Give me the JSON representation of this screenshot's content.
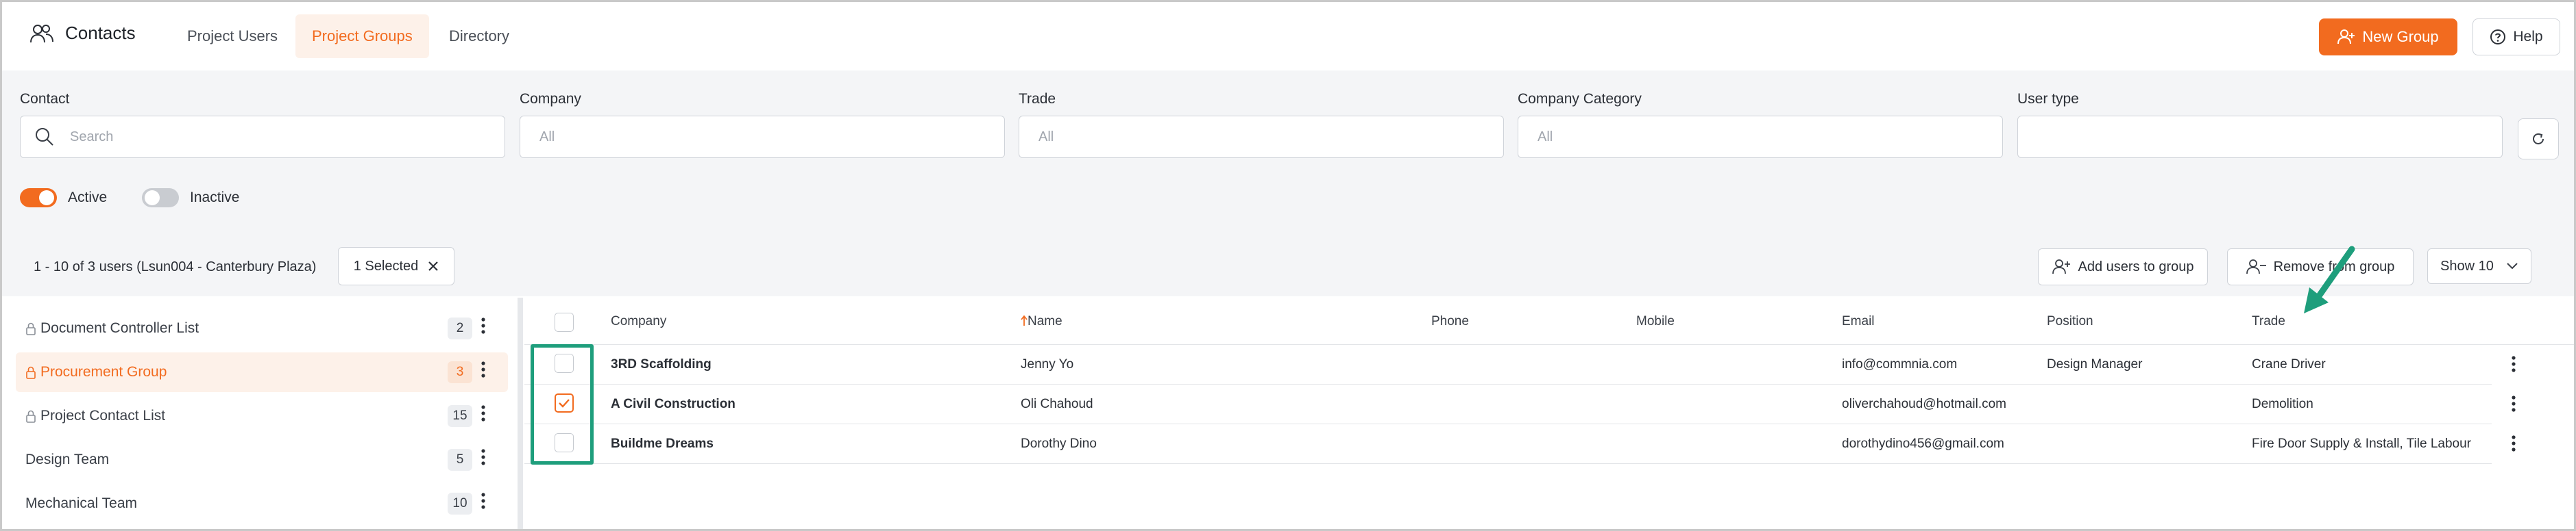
{
  "header": {
    "app_title": "Contacts",
    "tabs": [
      "Project Users",
      "Project Groups",
      "Directory"
    ],
    "active_tab": "Project Groups",
    "new_group_label": "New Group",
    "help_label": "Help"
  },
  "filters": {
    "contact_label": "Contact",
    "contact_placeholder": "Search",
    "company_label": "Company",
    "company_placeholder": "All",
    "trade_label": "Trade",
    "trade_placeholder": "All",
    "company_category_label": "Company Category",
    "company_category_placeholder": "All",
    "user_type_label": "User type",
    "user_type_placeholder": "",
    "active_label": "Active",
    "inactive_label": "Inactive"
  },
  "toolbar": {
    "count_text": "1 - 10 of 3 users (Lsun004 - Canterbury Plaza)",
    "selected_label": "1 Selected",
    "add_users_label": "Add users to group",
    "remove_label": "Remove from group",
    "show_label": "Show 10"
  },
  "groups": [
    {
      "name": "Document Controller List",
      "count": "2",
      "locked": true
    },
    {
      "name": "Procurement Group",
      "count": "3",
      "locked": true
    },
    {
      "name": "Project Contact List",
      "count": "15",
      "locked": true
    },
    {
      "name": "Design Team",
      "count": "5",
      "locked": false
    },
    {
      "name": "Mechanical Team",
      "count": "10",
      "locked": false
    }
  ],
  "table": {
    "columns": [
      "Company",
      "Name",
      "Phone",
      "Mobile",
      "Email",
      "Position",
      "Trade"
    ],
    "rows": [
      {
        "company": "3RD Scaffolding",
        "name": "Jenny Yo",
        "phone": "",
        "mobile": "",
        "email": "info@commnia.com",
        "position": "Design Manager",
        "trade": "Crane Driver"
      },
      {
        "company": "A Civil Construction",
        "name": "Oli Chahoud",
        "phone": "",
        "mobile": "",
        "email": "oliverchahoud@hotmail.com",
        "position": "",
        "trade": "Demolition"
      },
      {
        "company": "Buildme Dreams",
        "name": "Dorothy Dino",
        "phone": "",
        "mobile": "",
        "email": "dorothydino456@gmail.com",
        "position": "",
        "trade": "Fire Door Supply & Install, Tile Labour"
      }
    ]
  },
  "colors": {
    "accent": "#f26b1f",
    "highlight": "#1e9e7c"
  }
}
